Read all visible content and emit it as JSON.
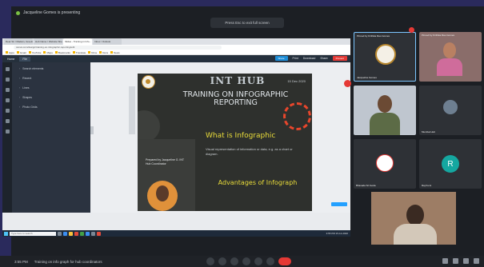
{
  "meeting": {
    "presenter_label": "Jacqueline Gomes is presenting",
    "escape_hint": "Press Esc to exit full screen",
    "time": "3:55 PM",
    "title": "Training on info graph for hub coordinators"
  },
  "browser": {
    "tabs": [
      "Dear Sir / Madam, Greetings...",
      "Hub Name / Website Sheet",
      "Slides - Training in Info...",
      "Inbox / Outlook"
    ],
    "url": "canva.com/design/training-on-infographic-reporting/edit",
    "bookmarks": [
      "Apps",
      "Gmail",
      "YouTube",
      "Maps",
      "Bookmarks",
      "Translate",
      "Drive",
      "Docs",
      "News"
    ]
  },
  "canva": {
    "top_items": [
      "Home",
      "File"
    ],
    "right_items": [
      "Share",
      "Print",
      "Download",
      "Share"
    ],
    "share_label": "Share",
    "present_label": "Present"
  },
  "side_panel": {
    "items": [
      "Search elements",
      "Recent",
      "Lines",
      "Shapes",
      "Photo Grids"
    ]
  },
  "slide": {
    "title": "INT HUB",
    "subtitle": "TRAINING ON INFOGRAPHIC REPORTING",
    "date": "15 Dec 2020",
    "what_is": "What is Infographic",
    "what_desc": "Visual representation of information or data, e.g. as a chart or diagram.",
    "advantages": "Advantages of Infograph",
    "prepared_by": "Prepared by Jacqueline G. INT Hub Coordinator"
  },
  "taskbar": {
    "search_placeholder": "Type here to search",
    "clock": "3:55 PM 15-12-2020"
  },
  "gallery": {
    "tiles": [
      {
        "name": "Jacqueline Gomes",
        "caption": "Pinned by Kirthika Rao Gomes"
      },
      {
        "name": "",
        "caption": "Pinned by Kirthika Rao Gomes"
      },
      {
        "name": "",
        "caption": ""
      },
      {
        "name": "Mumbai Hub",
        "caption": ""
      },
      {
        "name": "Bhavada Sri Goda",
        "caption": ""
      },
      {
        "name": "Raj Kumi",
        "caption": ""
      }
    ],
    "r_avatar_letter": "R"
  },
  "colors": {
    "accent_red": "#e53935",
    "canva_blue": "#1c8cd6",
    "slide_yellow": "#e9dc3a"
  }
}
